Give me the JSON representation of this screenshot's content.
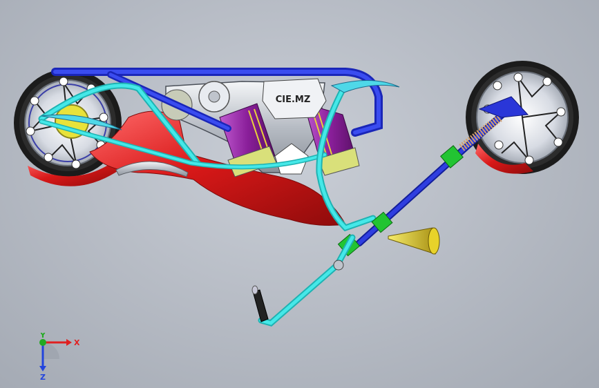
{
  "model": {
    "engine_badge": "CIE.MZ",
    "colors": {
      "frame_blue": "#1f2fd0",
      "frame_cyan": "#3fe2e2",
      "body_red": "#d81818",
      "engine_purple": "#9a2aa6",
      "rim_gray": "#cfd4dc",
      "tire_black": "#1a1a1a",
      "headlight_gold": "#d6c21a",
      "clamp_green": "#22c432",
      "spring_tan": "#d2a070"
    }
  },
  "triad": {
    "x_label": "X",
    "y_label": "Y",
    "z_label": "Z",
    "x_color": "#e02020",
    "y_color": "#22aa22",
    "z_color": "#2244dd"
  }
}
